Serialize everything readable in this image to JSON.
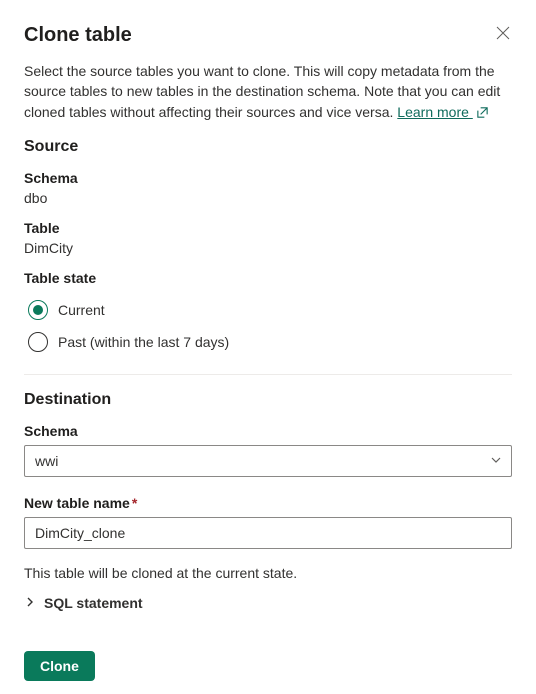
{
  "dialog": {
    "title": "Clone table",
    "description": "Select the source tables you want to clone. This will copy metadata from the source tables to new tables in the destination schema. Note that you can edit cloned tables without affecting their sources and vice versa. ",
    "learn_more_text": "Learn more "
  },
  "source": {
    "heading": "Source",
    "schema_label": "Schema",
    "schema_value": "dbo",
    "table_label": "Table",
    "table_value": "DimCity",
    "state_label": "Table state",
    "options": {
      "current": "Current",
      "past": "Past (within the last 7 days)"
    },
    "selected": "current"
  },
  "destination": {
    "heading": "Destination",
    "schema_label": "Schema",
    "schema_value": "wwi",
    "new_table_label": "New table name",
    "new_table_value": "DimCity_clone"
  },
  "helper": "This table will be cloned at the current state.",
  "sql_statement_label": "SQL statement",
  "footer": {
    "clone_label": "Clone"
  }
}
